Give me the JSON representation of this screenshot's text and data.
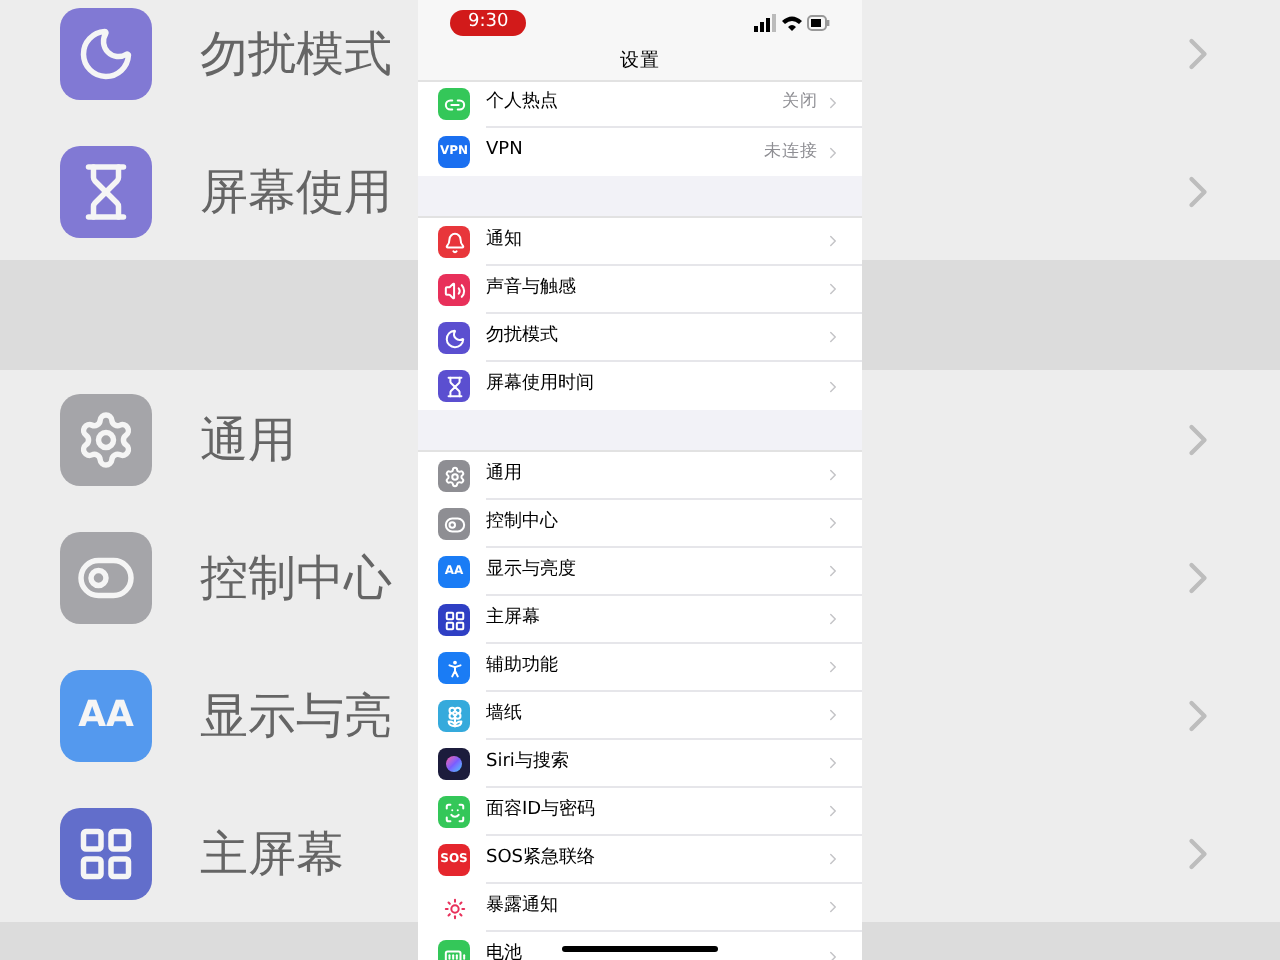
{
  "background": {
    "sections": [
      [
        {
          "kind": "moon",
          "label": "勿扰模式"
        },
        {
          "kind": "hourglass",
          "label": "屏幕使用"
        }
      ],
      [
        {
          "kind": "gear",
          "label": "通用"
        },
        {
          "kind": "toggles",
          "label": "控制中心"
        },
        {
          "kind": "display",
          "label": "显示与亮",
          "icon_text": "AA"
        },
        {
          "kind": "grid",
          "label": "主屏幕"
        }
      ]
    ]
  },
  "status_bar": {
    "time": "9:30"
  },
  "nav": {
    "title": "设置"
  },
  "sections": [
    [
      {
        "kind": "hotspot",
        "label": "个人热点",
        "value": "关闭"
      },
      {
        "kind": "vpn",
        "label": "VPN",
        "value": "未连接",
        "icon_text": "VPN"
      }
    ],
    [
      {
        "kind": "notify",
        "label": "通知"
      },
      {
        "kind": "sound",
        "label": "声音与触感"
      },
      {
        "kind": "moon",
        "label": "勿扰模式"
      },
      {
        "kind": "hourglass",
        "label": "屏幕使用时间"
      }
    ],
    [
      {
        "kind": "gear",
        "label": "通用"
      },
      {
        "kind": "toggles",
        "label": "控制中心"
      },
      {
        "kind": "display",
        "label": "显示与亮度",
        "icon_text": "AA"
      },
      {
        "kind": "grid",
        "label": "主屏幕"
      },
      {
        "kind": "access",
        "label": "辅助功能"
      },
      {
        "kind": "flower",
        "label": "墙纸"
      },
      {
        "kind": "siri",
        "label": "Siri与搜索"
      },
      {
        "kind": "face",
        "label": "面容ID与密码"
      },
      {
        "kind": "sos",
        "label": "SOS紧急联络",
        "icon_text": "SOS"
      },
      {
        "kind": "exposure",
        "label": "暴露通知"
      },
      {
        "kind": "battery",
        "label": "电池"
      }
    ]
  ]
}
